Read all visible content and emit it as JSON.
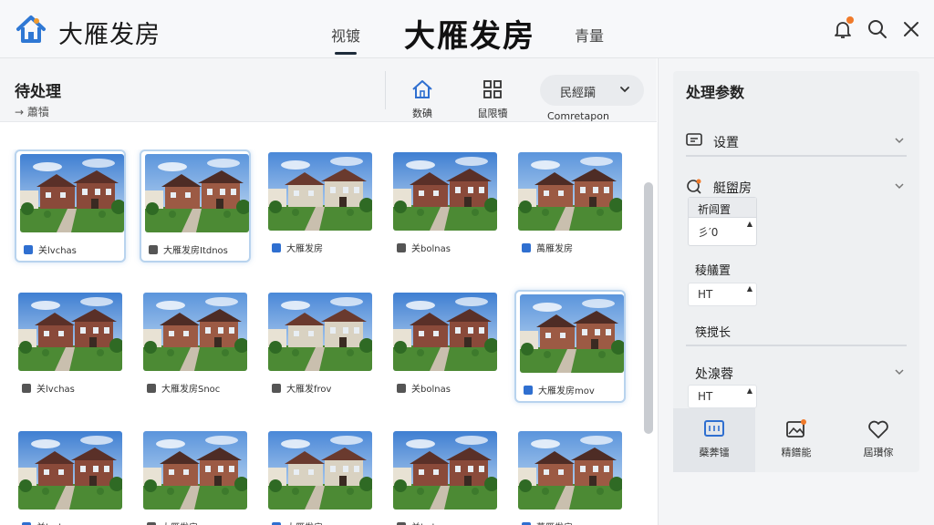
{
  "app": {
    "title": "大雁发房",
    "center_title": "大雁发房"
  },
  "nav": {
    "tabs": [
      {
        "label": "视镀",
        "active": true
      },
      {
        "label": "青量",
        "active": false
      }
    ]
  },
  "colors": {
    "accent": "#2f6fd0",
    "notif": "#f07a2a",
    "selection": "#b8d3ee"
  },
  "left": {
    "title": "待处理",
    "subtitle": "→ 蕭犢",
    "tools": [
      {
        "label": "数碘",
        "icon": "home-icon"
      },
      {
        "label": "鼠限犢",
        "icon": "grid-icon"
      }
    ],
    "dropdown": {
      "value": "民經躏",
      "label": "Comretapon"
    }
  },
  "cards": [
    {
      "caption": "关lvchas",
      "icon": "tag-icon",
      "icon_color": "#2f6fd0",
      "selected": true
    },
    {
      "caption": "大雁发房Itdnos",
      "icon": "home-icon",
      "icon_color": "#555",
      "selected": true
    },
    {
      "caption": "大雁发房",
      "icon": "tag-icon",
      "icon_color": "#2f6fd0",
      "selected": false
    },
    {
      "caption": "关bolnas",
      "icon": "home-icon",
      "icon_color": "#555",
      "selected": false
    },
    {
      "caption": "萬雁发房",
      "icon": "doc-icon",
      "icon_color": "#2f6fd0",
      "selected": false
    },
    {
      "caption": "关lvchas",
      "icon": "gear-icon",
      "icon_color": "#555",
      "selected": false
    },
    {
      "caption": "大雁发房Snoc",
      "icon": "film-icon",
      "icon_color": "#555",
      "selected": false
    },
    {
      "caption": "大雁发frov",
      "icon": "gear-icon",
      "icon_color": "#555",
      "selected": false
    },
    {
      "caption": "关bolnas",
      "icon": "gear-icon",
      "icon_color": "#555",
      "selected": false
    },
    {
      "caption": "大雁发房mov",
      "icon": "doc-icon",
      "icon_color": "#2f6fd0",
      "selected": true
    },
    {
      "caption": "关lvchas",
      "icon": "tag-icon",
      "icon_color": "#2f6fd0",
      "selected": false
    },
    {
      "caption": "大雁发房",
      "icon": "home-icon",
      "icon_color": "#555",
      "selected": false
    },
    {
      "caption": "大雁发房",
      "icon": "tag-icon",
      "icon_color": "#2f6fd0",
      "selected": false
    },
    {
      "caption": "关bolnas",
      "icon": "film-icon",
      "icon_color": "#555",
      "selected": false
    },
    {
      "caption": "萬雁发房",
      "icon": "doc-icon",
      "icon_color": "#2f6fd0",
      "selected": false
    }
  ],
  "right": {
    "title": "处理参数",
    "sections": [
      {
        "label": "设置",
        "icon": "window-icon"
      },
      {
        "label": "艇盥房",
        "icon": "search-badge-icon"
      }
    ],
    "param_box": {
      "header": "祈闾置",
      "value": "彡′0"
    },
    "param2": {
      "label": "稜艤置",
      "value": "HT"
    },
    "param3": {
      "label": "筷搅长"
    },
    "section3": {
      "label": "处湶蓉",
      "value": "HT"
    },
    "actions": [
      {
        "label": "蘗莾镭",
        "icon": "monitor-icon",
        "active": true
      },
      {
        "label": "精鐠能",
        "icon": "image-icon",
        "active": false
      },
      {
        "label": "屆瓚傢",
        "icon": "heart-icon",
        "active": false
      }
    ]
  }
}
